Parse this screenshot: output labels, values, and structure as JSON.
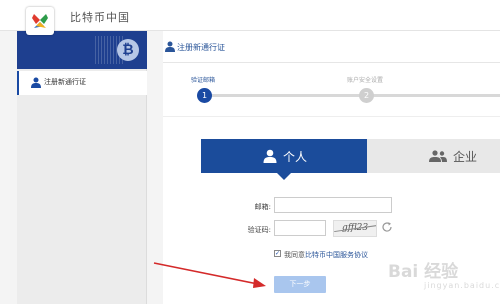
{
  "app": {
    "brand": "比特币中国"
  },
  "sidebar": {
    "items": [
      {
        "label": "注册新通行证",
        "icon": "user-icon",
        "active": true
      }
    ],
    "banner_icon": "bitcoin-icon",
    "banner_symbol": "₿"
  },
  "main": {
    "title": "注册新通行证",
    "steps": [
      {
        "number": "1",
        "label": "验证邮箱",
        "active": true
      },
      {
        "number": "2",
        "label": "账户安全设置",
        "active": false
      }
    ],
    "tabs": [
      {
        "label": "个人",
        "icon": "user-icon",
        "active": true
      },
      {
        "label": "企业",
        "icon": "users-icon",
        "active": false
      }
    ]
  },
  "form": {
    "email_label": "邮箱:",
    "email_value": "",
    "captcha_label": "验证码:",
    "captcha_value": "",
    "captcha_image_text": "gffl23",
    "agree_prefix": "我同意",
    "agree_link": "比特币中国服务协议",
    "agree_checked": true,
    "next_label": "下一步"
  },
  "colors": {
    "accent": "#1b4c9b",
    "link": "#2a5599",
    "button_disabled": "#a9c6ee",
    "annotation_arrow": "#d42a2a"
  },
  "watermark": {
    "text": "Bai 经验",
    "sub": "jingyan.baidu.com"
  }
}
